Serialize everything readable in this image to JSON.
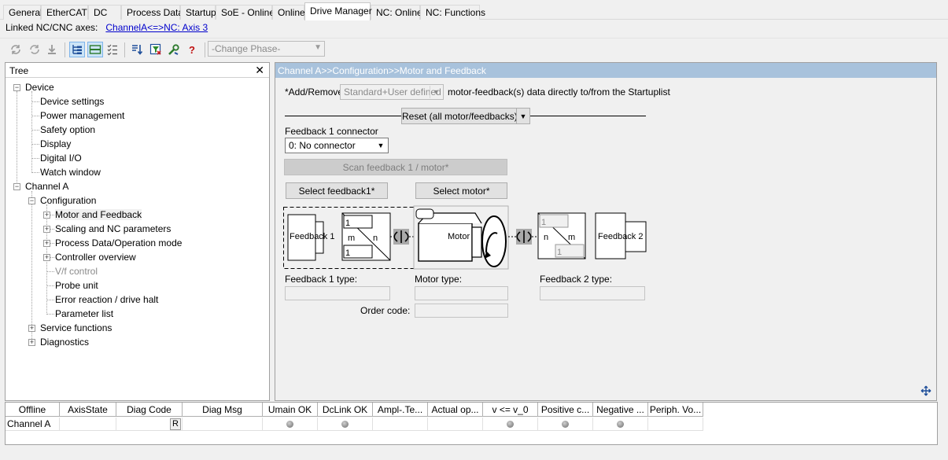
{
  "tabs": [
    "General",
    "EtherCAT",
    "DC",
    "Process Data",
    "Startup",
    "SoE - Online",
    "Online",
    "Drive Manager",
    "NC: Online",
    "NC: Functions"
  ],
  "linked": {
    "label": "Linked NC/CNC axes:",
    "link": "ChannelA<=>NC: Axis 3"
  },
  "toolbar": {
    "phase_placeholder": "-Change Phase-",
    "help_glyph": "?"
  },
  "tree": {
    "title": "Tree",
    "close_glyph": "✕",
    "items": [
      "Device",
      "Device settings",
      "Power management",
      "Safety option",
      "Display",
      "Digital I/O",
      "Watch window",
      "Channel A",
      "Configuration",
      "Motor and Feedback",
      "Scaling and NC parameters",
      "Process Data/Operation mode",
      "Controller overview",
      "V/f control",
      "Probe unit",
      "Error reaction / drive halt",
      "Parameter list",
      "Service functions",
      "Diagnostics"
    ]
  },
  "main": {
    "path": "Channel A>>Configuration>>Motor and Feedback",
    "add_remove_label": "*Add/Remove",
    "add_remove_value": "Standard+User defined",
    "add_remove_suffix": "motor-feedback(s) data directly to/from the Startuplist",
    "reset_button": "Reset (all motor/feedbacks)*",
    "feedback1_connector_label": "Feedback 1 connector",
    "feedback1_connector_value": "0: No connector",
    "scan_button": "Scan feedback 1 / motor*",
    "select_feedback_button": "Select feedback1*",
    "select_motor_button": "Select motor*",
    "diagram": {
      "feedback1": "Feedback 1",
      "feedback2": "Feedback 2",
      "motor": "Motor",
      "m": "m",
      "n": "n",
      "fb1_top": "1",
      "fb1_bottom": "1",
      "fb2_top": "1",
      "fb2_bottom": "1"
    },
    "feedback1_type_label": "Feedback 1 type:",
    "motor_type_label": "Motor type:",
    "feedback2_type_label": "Feedback 2 type:",
    "order_code_label": "Order code:"
  },
  "status": {
    "columns": [
      "Offline",
      "AxisState",
      "Diag Code",
      "Diag Msg",
      "Umain OK",
      "DcLink OK",
      "Ampl-.Te...",
      "Actual op...",
      "v <= v_0",
      "Positive c...",
      "Negative ...",
      "Periph. Vo..."
    ],
    "row_label": "Channel A",
    "r_button": "R"
  },
  "colors": {
    "path_bar": "#a8c2dc",
    "link": "#0000cc"
  }
}
